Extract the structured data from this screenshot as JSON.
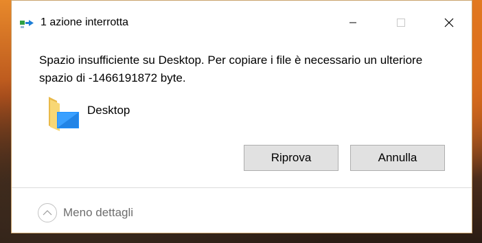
{
  "window": {
    "title": "1 azione interrotta"
  },
  "message": {
    "text": "Spazio insufficiente su Desktop. Per copiare i file è necessario un ulteriore spazio di -1466191872 byte."
  },
  "location": {
    "name": "Desktop",
    "icon": "folder-desktop-icon"
  },
  "buttons": {
    "retry_label": "Riprova",
    "cancel_label": "Annulla"
  },
  "details": {
    "toggle_label": "Meno dettagli"
  },
  "colors": {
    "button_bg": "#e1e1e1",
    "button_border": "#adadad",
    "details_text": "#6d6d6d",
    "folder_yellow": "#f8d775",
    "desktop_blue": "#1e90ff"
  }
}
